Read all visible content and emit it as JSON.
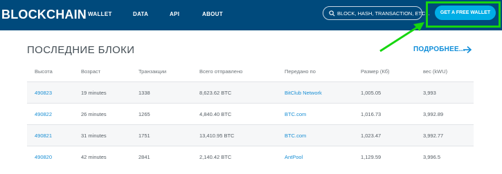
{
  "header": {
    "logo": "BLOCKCHAIN",
    "nav": [
      "WALLET",
      "DATA",
      "API",
      "ABOUT"
    ],
    "search_placeholder": "BLOCK, HASH, TRANSACTION, ETC...",
    "cta_label": "GET A FREE WALLET"
  },
  "colors": {
    "header_bg": "#004a7c",
    "accent": "#00aee6",
    "highlight": "#16d60f",
    "link": "#1a8fd4"
  },
  "section": {
    "title": "ПОСЛЕДНИЕ БЛОКИ",
    "more_label": "ПОДРОБНЕЕ..."
  },
  "table": {
    "columns": [
      "Высота",
      "Возраст",
      "Транзакции",
      "Всего отправлено",
      "Передано по",
      "Размер (Кб)",
      "вес (kWU)"
    ],
    "rows": [
      [
        "490823",
        "19 minutes",
        "1338",
        "8,623.62 BTC",
        "BitClub Network",
        "1,005.05",
        "3,993"
      ],
      [
        "490822",
        "26 minutes",
        "1265",
        "4,840.40 BTC",
        "BTC.com",
        "1,016.73",
        "3,992.89"
      ],
      [
        "490821",
        "31 minutes",
        "1751",
        "13,410.95 BTC",
        "BTC.com",
        "1,023.47",
        "3,992.77"
      ],
      [
        "490820",
        "42 minutes",
        "2841",
        "2,140.42 BTC",
        "AntPool",
        "1,129.59",
        "3,996.5"
      ]
    ]
  }
}
